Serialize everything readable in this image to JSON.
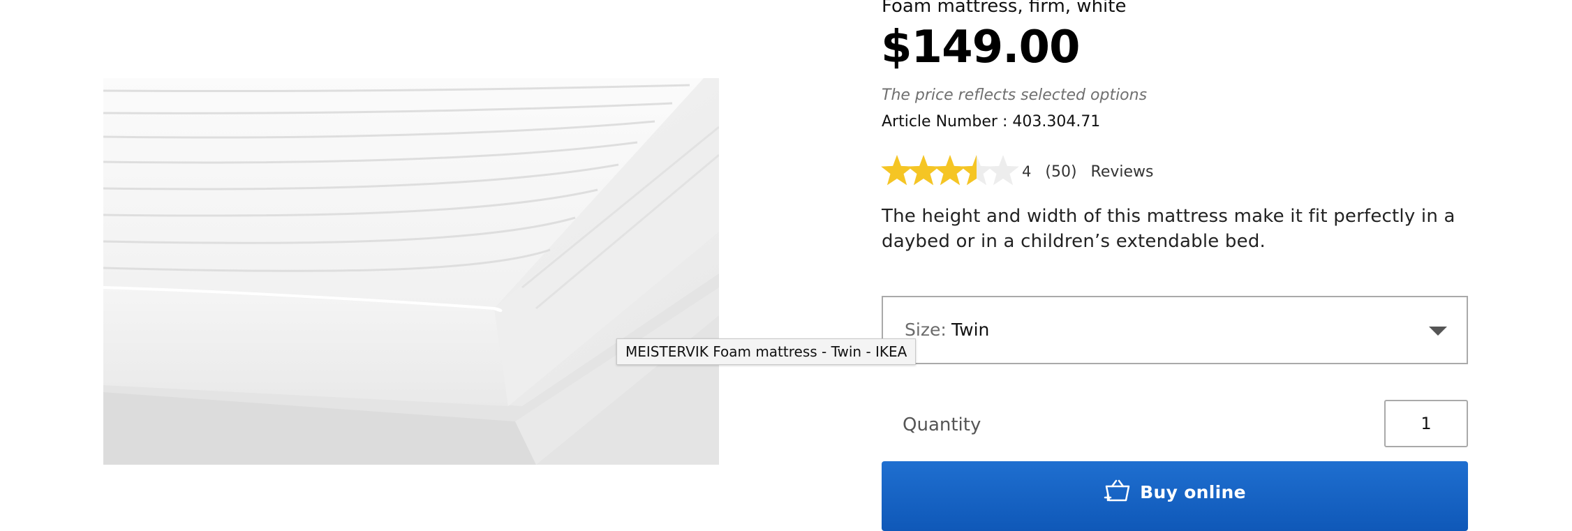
{
  "product": {
    "subtitle": "Foam mattress, firm, white",
    "price": "$149.00",
    "price_note": "The price reflects selected options",
    "article_label": "Article Number : ",
    "article_number": "403.304.71",
    "rating": {
      "stars_filled_fraction": 0.7,
      "score": "4",
      "count": "(50)",
      "reviews_label": "Reviews"
    },
    "description": "The height and width of this mattress make it fit perfectly in a daybed or in a children’s extendable bed.",
    "size": {
      "label": "Size:",
      "value": "Twin"
    },
    "quantity": {
      "label": "Quantity",
      "value": "1"
    },
    "buy_button_label": "Buy online"
  },
  "tooltip": "MEISTERVIK Foam mattress - Twin - IKEA",
  "icons": {
    "star": "star-icon",
    "dropdown": "chevron-down-icon",
    "basket": "basket-icon"
  },
  "colors": {
    "star_filled": "#f5c524",
    "star_empty": "#ededed",
    "buy_button": "#1565c0",
    "price_note": "#6f6f6f",
    "border": "#a9a9a9"
  }
}
